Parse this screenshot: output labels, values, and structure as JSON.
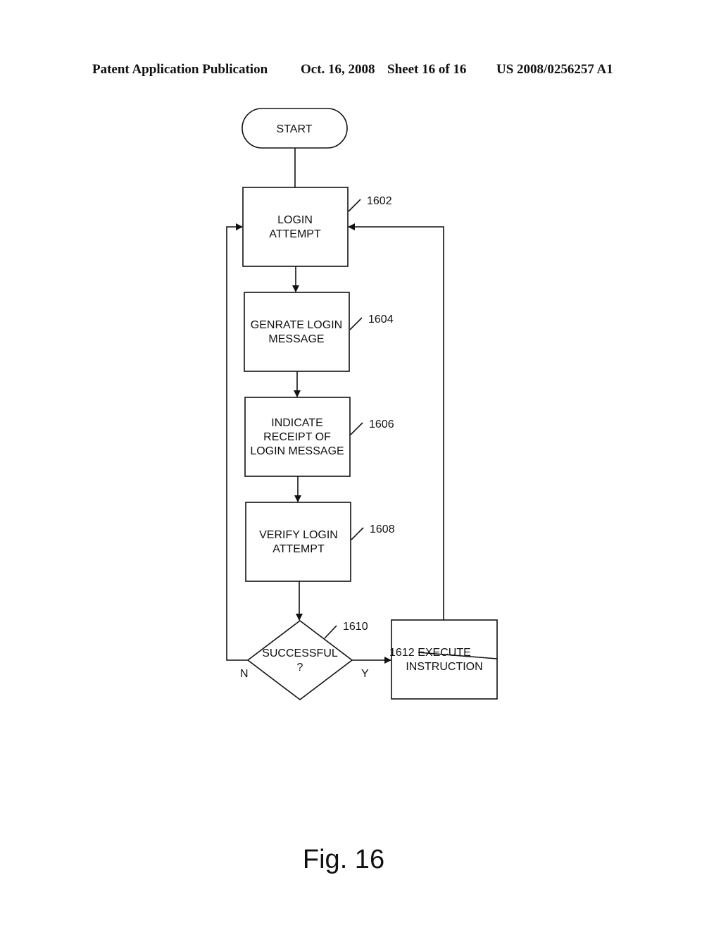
{
  "header": {
    "publication": "Patent Application Publication",
    "date": "Oct. 16, 2008",
    "sheet": "Sheet 16 of 16",
    "number": "US 2008/0256257 A1"
  },
  "flowchart": {
    "start": "START",
    "steps": [
      {
        "ref": "1602",
        "lines": [
          "LOGIN",
          "ATTEMPT"
        ]
      },
      {
        "ref": "1604",
        "lines": [
          "GENRATE LOGIN",
          "MESSAGE"
        ]
      },
      {
        "ref": "1606",
        "lines": [
          "INDICATE",
          "RECEIPT OF",
          "LOGIN MESSAGE"
        ]
      },
      {
        "ref": "1608",
        "lines": [
          "VERIFY LOGIN",
          "ATTEMPT"
        ]
      }
    ],
    "decision": {
      "ref": "1610",
      "lines": [
        "SUCCESSFUL",
        "?"
      ],
      "no_label": "N",
      "yes_label": "Y"
    },
    "execute": {
      "ref": "1612",
      "lines": [
        "EXECUTE",
        "INSTRUCTION"
      ]
    }
  },
  "figure_label": "Fig. 16"
}
